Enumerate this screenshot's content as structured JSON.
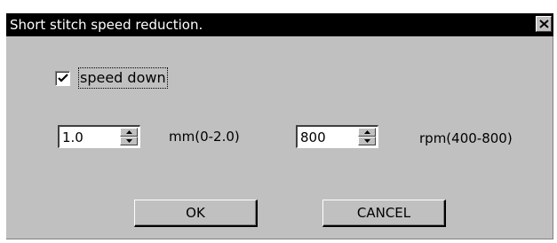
{
  "window": {
    "title": "Short stitch speed reduction.",
    "close_icon": "close-icon"
  },
  "speed_down": {
    "label": "speed down",
    "checked": true
  },
  "length_field": {
    "value": "1.0",
    "unit_label": "mm(0-2.0)"
  },
  "rpm_field": {
    "value": "800",
    "unit_label": "rpm(400-800)"
  },
  "buttons": {
    "ok_label": "OK",
    "cancel_label": "CANCEL"
  }
}
